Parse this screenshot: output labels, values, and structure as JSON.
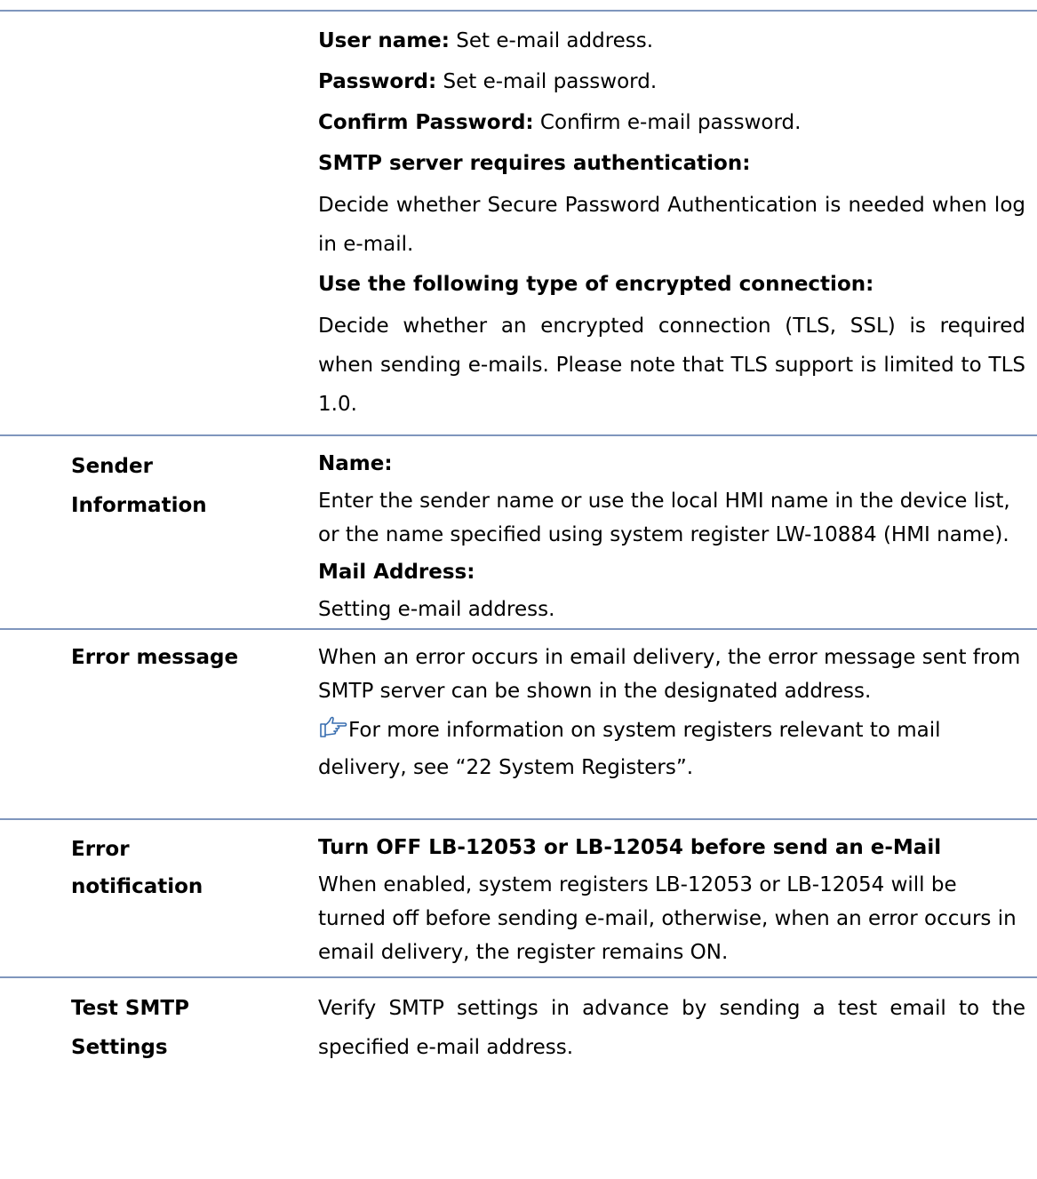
{
  "rows": [
    {
      "label_lines": [],
      "content": {
        "user_name_label": "User name:",
        "user_name_text": " Set e-mail address.",
        "password_label": "Password:",
        "password_text": " Set e-mail password.",
        "confirm_label": "Confirm Password:",
        "confirm_text": " Confirm e-mail password.",
        "smtp_auth_heading": "SMTP server requires authentication:",
        "smtp_auth_text": "Decide whether Secure Password Authentication is needed when log in e-mail.",
        "encrypt_heading": "Use the following type of encrypted connection:",
        "encrypt_text": "Decide whether an encrypted connection (TLS, SSL) is required when sending e-mails. Please note that TLS support is limited to TLS 1.0."
      }
    },
    {
      "label_lines": [
        "Sender",
        "Information"
      ],
      "content": {
        "name_heading": "Name:",
        "name_text": "Enter the sender name or use the local HMI name in the device list, or the name specified using system register LW-10884 (HMI name).",
        "mail_heading": "Mail Address:",
        "mail_text": "Setting e-mail address."
      }
    },
    {
      "label_lines": [
        "Error message"
      ],
      "content": {
        "text": "When an error occurs in email delivery, the error message sent from SMTP server can be shown in the designated address.",
        "note_icon": "pointing-hand-icon",
        "note_text": "For more information on system registers relevant to mail delivery, see “22 System Registers”."
      }
    },
    {
      "label_lines": [
        "Error",
        "notification"
      ],
      "content": {
        "heading": "Turn OFF LB-12053 or LB-12054 before send an e-Mail",
        "text": "When enabled, system registers LB-12053 or LB-12054 will be turned off before sending e-mail, otherwise, when an error occurs in email delivery, the register remains ON."
      }
    },
    {
      "label_lines": [
        "Test SMTP",
        "Settings"
      ],
      "content": {
        "text": "Verify SMTP settings in advance by sending a test email to the specified e-mail address."
      }
    }
  ],
  "colors": {
    "rule": "#7f96bd",
    "icon_stroke": "#3a6fb0"
  }
}
